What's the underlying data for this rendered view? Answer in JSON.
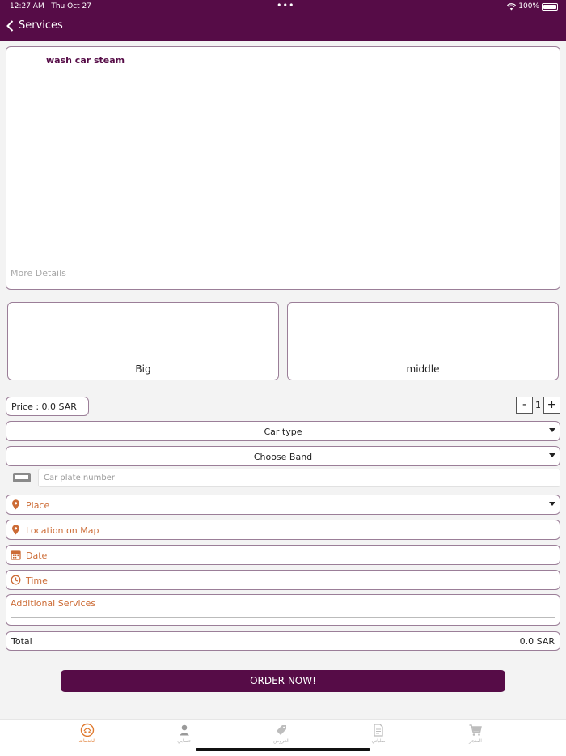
{
  "status_bar": {
    "time": "12:27 AM",
    "date": "Thu Oct 27",
    "dots": "•••",
    "battery": "100%"
  },
  "header": {
    "back_label": "Services"
  },
  "service": {
    "title": "wash car steam",
    "more_details": "More Details"
  },
  "sizes": [
    {
      "label": "Big"
    },
    {
      "label": "middle"
    }
  ],
  "price": {
    "label": "Price :",
    "value": "0.0 SAR"
  },
  "quantity": {
    "minus": "-",
    "value": "1",
    "plus": "+"
  },
  "car_type": {
    "label": "Car type"
  },
  "brand": {
    "label": "Choose Band"
  },
  "plate": {
    "placeholder": "Car plate number"
  },
  "fields": {
    "place": "Place",
    "location": "Location on Map",
    "date": "Date",
    "time": "Time"
  },
  "additional": {
    "label": "Additional Services"
  },
  "total": {
    "label": "Total",
    "value": "0.0 SAR"
  },
  "order_button": "ORDER NOW!",
  "tabs": [
    {
      "label": "الخدمات",
      "icon": "services-icon",
      "active": true
    },
    {
      "label": "حسابي",
      "icon": "user-icon",
      "active": false
    },
    {
      "label": "العروض",
      "icon": "tag-icon",
      "active": false
    },
    {
      "label": "طلباتي",
      "icon": "document-icon",
      "active": false
    },
    {
      "label": "المتجر",
      "icon": "cart-icon",
      "active": false
    }
  ],
  "colors": {
    "brand": "#560c47",
    "accent": "#cc6b35",
    "active_tab": "#e07a2f"
  }
}
